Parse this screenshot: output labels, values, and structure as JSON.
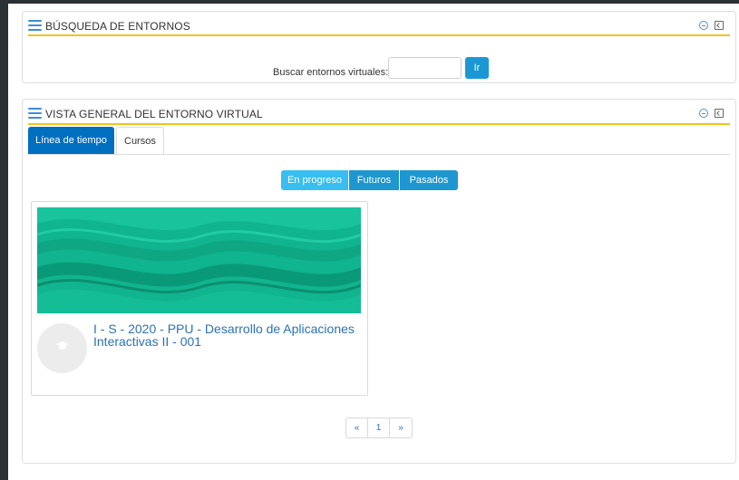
{
  "search_block": {
    "title": "BÚSQUEDA DE ENTORNOS",
    "search_label": "Buscar entornos virtuales:",
    "search_value": "",
    "go_label": "Ir"
  },
  "overview_block": {
    "title": "VISTA GENERAL DEL ENTORNO VIRTUAL",
    "tabs": [
      {
        "label": "Línea de tiempo",
        "active": true
      },
      {
        "label": "Cursos",
        "active": false
      }
    ],
    "filters": [
      {
        "label": "En progreso",
        "selected": true
      },
      {
        "label": "Futuros",
        "selected": false
      },
      {
        "label": "Pasados",
        "selected": false
      }
    ],
    "courses": [
      {
        "name": "I - S - 2020 - PPU - Desarrollo de Aplicaciones Interactivas II - 001"
      }
    ],
    "pagination": {
      "prev": "«",
      "current": "1",
      "next": "»"
    }
  },
  "colors": {
    "accent_yellow": "#f0c419",
    "primary_blue": "#006fbf",
    "button_blue": "#1b98d4",
    "selected_segment": "#38bef0",
    "course_image_teal": "#10b48e",
    "link_blue": "#2a72b5",
    "dark_frame": "#2b3035"
  },
  "icons": [
    "hamburger-icon",
    "collapse-icon",
    "dock-icon",
    "graduation-cap-icon"
  ]
}
